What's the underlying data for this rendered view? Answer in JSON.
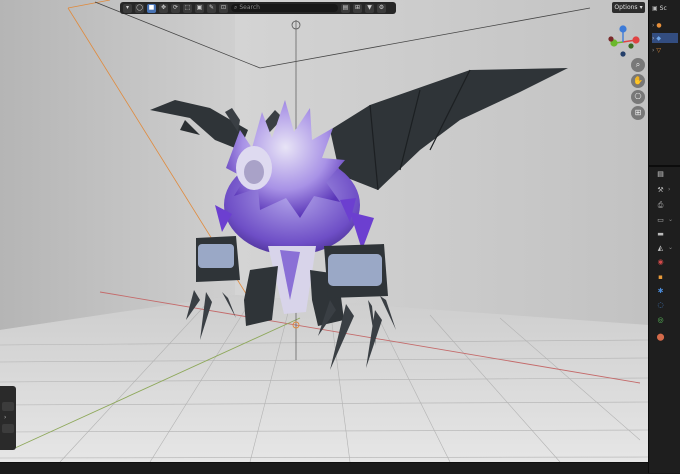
{
  "header": {
    "search": {
      "placeholder": "Search"
    },
    "options_label": "Options",
    "options_arrow": "▾"
  },
  "outliner": {
    "label": "Sc"
  },
  "gizmo": {
    "x_label": "X",
    "y_label": "Y",
    "z_label": "Z"
  },
  "colors": {
    "accent": "#4772b3",
    "axis_x": "#e04242",
    "axis_y": "#6bb82c",
    "axis_z": "#3d7bd8",
    "viewport_bg": "#c6c6c6",
    "ui_dark": "#1e1e1e"
  },
  "toolbar_icons": [
    "view-layer-icon",
    "select-box-icon",
    "cursor-icon",
    "move-icon",
    "rotate-icon",
    "scale-icon",
    "transform-icon",
    "annotate-icon",
    "measure-icon"
  ],
  "nav_buttons": [
    "zoom-icon",
    "hand-pan-icon",
    "camera-icon",
    "grid-icon"
  ],
  "properties_tabs": [
    "tool-icon",
    "render-icon",
    "output-icon",
    "view-layer-icon",
    "scene-icon",
    "world-icon",
    "object-icon",
    "modifier-icon",
    "particles-icon",
    "physics-icon",
    "constraints-icon",
    "data-icon",
    "material-icon"
  ]
}
